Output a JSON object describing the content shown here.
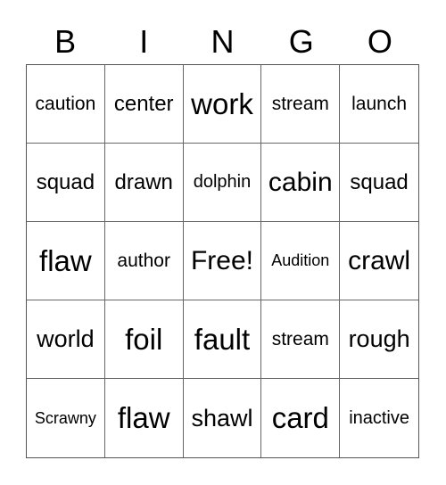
{
  "header": [
    "B",
    "I",
    "N",
    "G",
    "O"
  ],
  "rows": [
    [
      "caution",
      "center",
      "work",
      "stream",
      "launch"
    ],
    [
      "squad",
      "drawn",
      "dolphin",
      "cabin",
      "squad"
    ],
    [
      "flaw",
      "author",
      "Free!",
      "Audition",
      "crawl"
    ],
    [
      "world",
      "foil",
      "fault",
      "stream",
      "rough"
    ],
    [
      "Scrawny",
      "flaw",
      "shawl",
      "card",
      "inactive"
    ]
  ]
}
